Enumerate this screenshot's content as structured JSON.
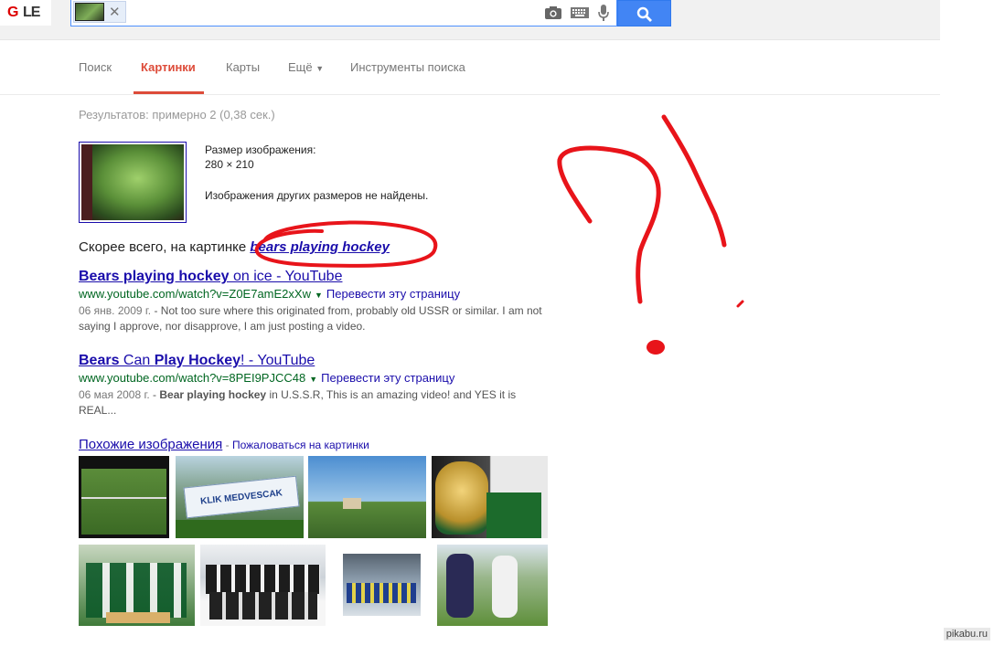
{
  "header": {
    "logo_text_a": "G",
    "logo_text_b": "LE",
    "search_value": "",
    "icons": [
      "camera-icon",
      "keyboard-icon",
      "microphone-icon",
      "search-icon"
    ]
  },
  "tabs": [
    "Поиск",
    "Картинки",
    "Карты",
    "Ещё",
    "Инструменты поиска"
  ],
  "stats": "Результатов: примерно 2 (0,38 сек.)",
  "query_image": {
    "size_label": "Размер изображения:",
    "size_value": "280 × 210",
    "other_sizes": "Изображения других размеров не найдены."
  },
  "best_guess": {
    "prefix": "Скорее всего, на картинке",
    "query": "bears playing hockey"
  },
  "results": [
    {
      "title_bold": "Bears playing hockey",
      "title_rest": " on ice - YouTube",
      "url": "www.youtube.com/watch?v=Z0E7amE2xXw",
      "translate": "Перевести эту страницу",
      "date": "06 янв. 2009 г.",
      "snippet": " - Not too sure where this originated from, probably old USSR or similar. I am not saying I approve, nor disapprove, I am just posting a video."
    },
    {
      "title_bold": "Bears",
      "title_mid": " Can ",
      "title_bold2": "Play Hockey",
      "title_rest": "! - YouTube",
      "url": "www.youtube.com/watch?v=8PEI9PJCC48",
      "translate": "Перевести эту страницу",
      "date": "06 мая 2008 г.",
      "snippet_bold": "Bear playing hockey",
      "snippet": " in U.S.S.R, This is an amazing video! and YES it is REAL..."
    }
  ],
  "similar": {
    "label": "Похожие изображения",
    "separator": " - ",
    "report": "Пожаловаться на картинки",
    "banner_text": "KLIK MEDVESCAK ZAGREB"
  },
  "watermark": "pikabu.ru",
  "colors": {
    "link": "#1a0dab",
    "url_green": "#006621",
    "active_tab": "#dd4b39",
    "search_button": "#4285f4",
    "scribble": "#e8141a"
  }
}
